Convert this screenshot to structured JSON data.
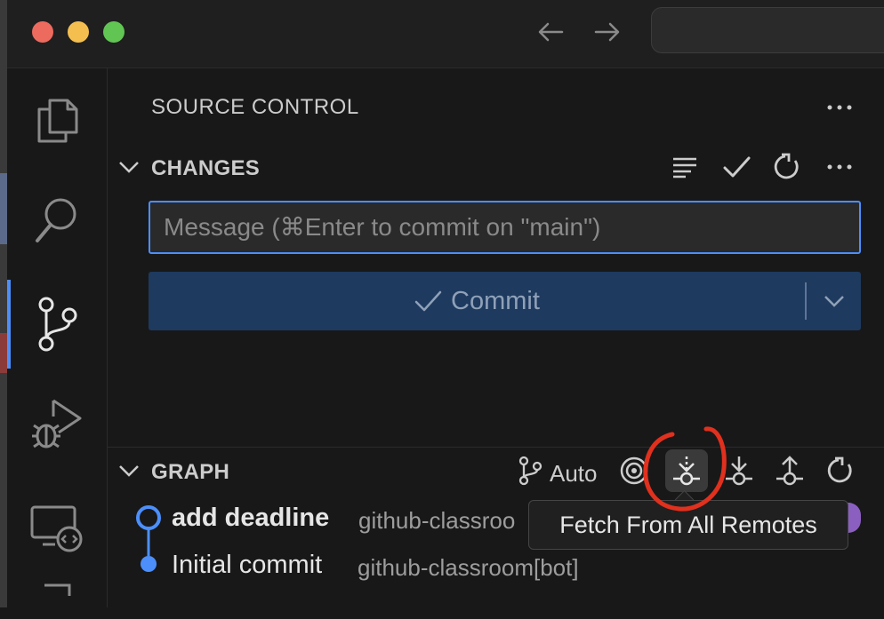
{
  "window": {
    "traffic_lights": {
      "close": "#ed6a5e",
      "minimize": "#f4bf4f",
      "maximize": "#61c554"
    },
    "nav_back_icon": "arrow-left-icon",
    "nav_forward_icon": "arrow-right-icon"
  },
  "activity_bar": {
    "items": [
      {
        "name": "explorer",
        "icon": "files-icon",
        "active": false
      },
      {
        "name": "search",
        "icon": "search-icon",
        "active": false
      },
      {
        "name": "source-control",
        "icon": "source-control-icon",
        "active": true
      },
      {
        "name": "run-and-debug",
        "icon": "run-debug-icon",
        "active": false
      },
      {
        "name": "remote-explorer",
        "icon": "remote-explorer-icon",
        "active": false
      }
    ]
  },
  "sidebar": {
    "title": "SOURCE CONTROL",
    "changes": {
      "label": "CHANGES",
      "message_placeholder": "Message (⌘Enter to commit on \"main\")",
      "message_value": "",
      "commit_label": "Commit",
      "actions": [
        "view-as-tree-icon",
        "commit-check-icon",
        "refresh-icon",
        "more-actions-icon"
      ]
    },
    "graph": {
      "label": "GRAPH",
      "auto_label": "Auto",
      "actions": [
        "branch-icon",
        "target-icon",
        "fetch-icon",
        "pull-icon",
        "push-icon",
        "refresh-icon"
      ],
      "commits": [
        {
          "message": "add deadline",
          "author": "github-classroo"
        },
        {
          "message": "Initial commit",
          "author": "github-classroom[bot]"
        }
      ]
    }
  },
  "tooltip": {
    "text": "Fetch From All Remotes"
  },
  "colors": {
    "accent": "#4c8ffb",
    "commit_button_bg": "#1e3a5f",
    "annotation_circle": "#e0301e",
    "avatar": "#8b5fbf"
  }
}
